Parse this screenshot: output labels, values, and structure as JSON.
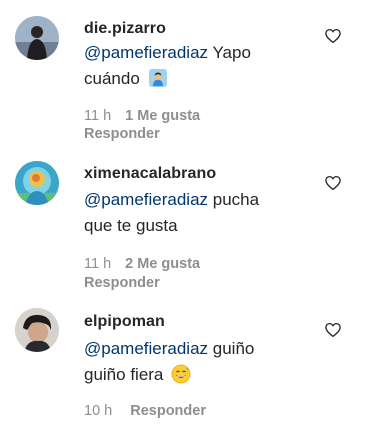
{
  "comments": [
    {
      "username": "die.pizarro",
      "mention": "@pamefieradiaz",
      "text_line1": " Yapo",
      "text_line2": "cuándo",
      "emoji": "person-shrugging-emoji",
      "time": "11 h",
      "likes": "1 Me gusta",
      "reply": "Responder"
    },
    {
      "username": "ximenacalabrano",
      "mention": "@pamefieradiaz",
      "text_line1": " pucha",
      "text_line2": "que te gusta",
      "time": "11 h",
      "likes": "2 Me gusta",
      "reply": "Responder"
    },
    {
      "username": "elpipoman",
      "mention": "@pamefieradiaz",
      "text_line1": " guiño",
      "text_line2": "guiño fiera",
      "emoji": "grinning-sweat-emoji",
      "time": "10 h",
      "reply": "Responder"
    }
  ],
  "icons": {
    "like": "heart-outline-icon"
  },
  "colors": {
    "text": "#262626",
    "mention": "#00376b",
    "meta": "#8e8e8e"
  }
}
